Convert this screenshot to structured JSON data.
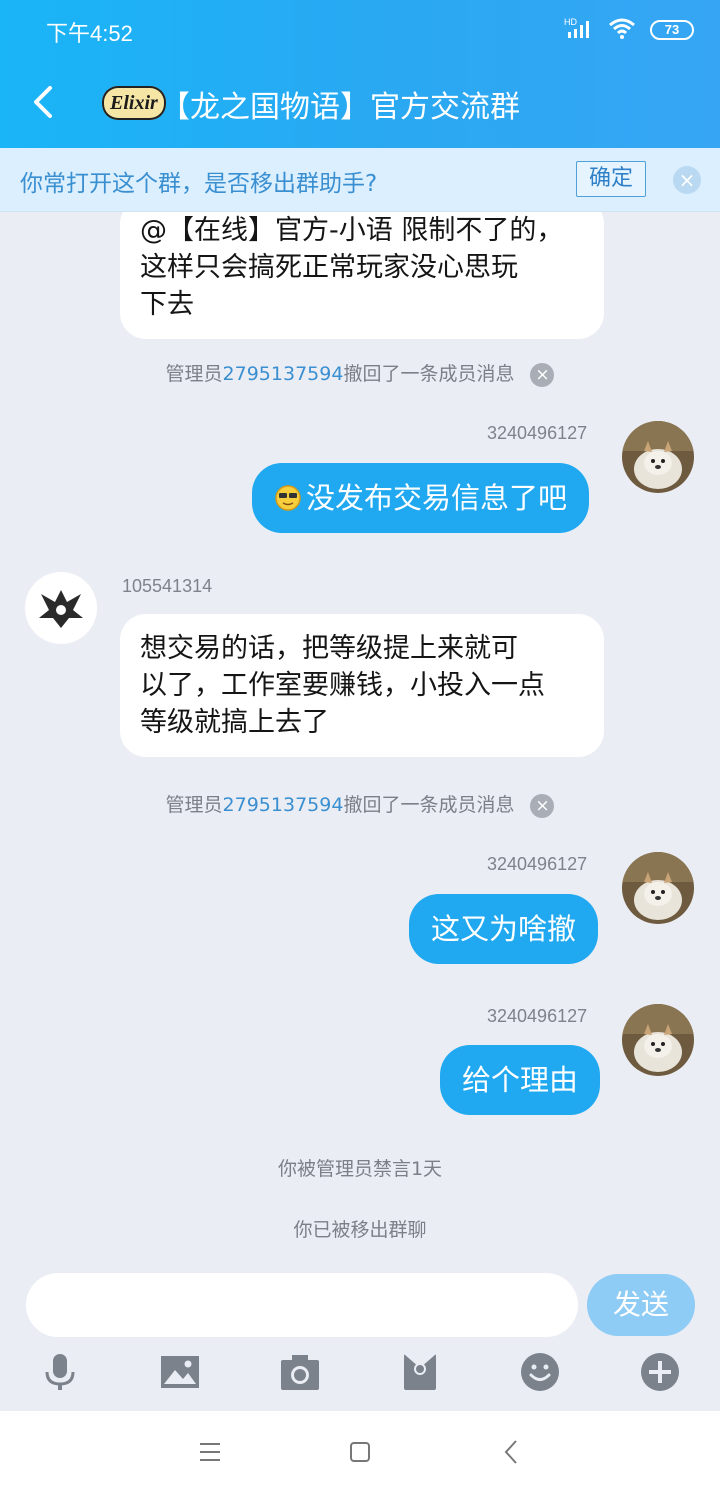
{
  "status_bar": {
    "time": "下午4:52",
    "battery": "73",
    "network": "HD"
  },
  "header": {
    "group_logo_text": "Elixir",
    "title": "【龙之国物语】官方交流群"
  },
  "notice": {
    "text": "你常打开这个群，是否移出群助手?",
    "confirm_label": "确定"
  },
  "messages": [
    {
      "type": "left-bubble-partial",
      "lines": [
        "@【在线】官方-小语 限制不了的，",
        "这样只会搞死正常玩家没心思玩",
        "下去"
      ]
    },
    {
      "type": "system",
      "prefix": "管理员",
      "link": "2795137594",
      "suffix": "撤回了一条成员消息"
    },
    {
      "type": "right",
      "sender": "3240496127",
      "emoji": "sunglasses-emoji",
      "text": "没发布交易信息了吧"
    },
    {
      "type": "left",
      "sender": "105541314",
      "lines": [
        "想交易的话，把等级提上来就可",
        "以了，工作室要赚钱，小投入一点",
        "等级就搞上去了"
      ]
    },
    {
      "type": "system",
      "prefix": "管理员",
      "link": "2795137594",
      "suffix": "撤回了一条成员消息"
    },
    {
      "type": "right",
      "sender": "3240496127",
      "text": "这又为啥撤"
    },
    {
      "type": "right",
      "sender": "3240496127",
      "text": "给个理由"
    },
    {
      "type": "system_plain",
      "text": "你被管理员禁言1天"
    },
    {
      "type": "system_plain",
      "text": "你已被移出群聊"
    }
  ],
  "input": {
    "placeholder": "",
    "send_label": "发送"
  },
  "toolbar": [
    "microphone-icon",
    "image-icon",
    "camera-icon",
    "red-packet-icon",
    "emoji-icon",
    "plus-icon"
  ],
  "colors": {
    "accent": "#20a9f0",
    "header": "#1fb1f6",
    "link": "#3a8fd1"
  }
}
